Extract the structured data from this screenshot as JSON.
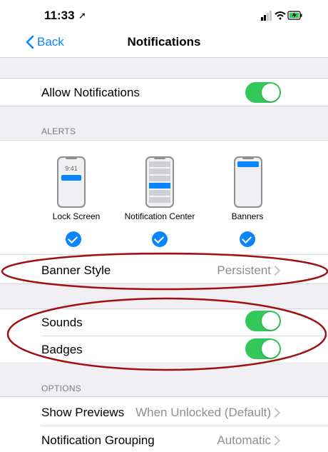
{
  "status_bar": {
    "time": "11:33"
  },
  "nav": {
    "back_label": "Back",
    "title": "Notifications"
  },
  "allow_notifications": {
    "label": "Allow Notifications",
    "enabled": true
  },
  "alerts": {
    "header": "ALERTS",
    "lock_screen": {
      "label": "Lock Screen",
      "preview_time": "9:41",
      "selected": true
    },
    "notification_center": {
      "label": "Notification Center",
      "selected": true
    },
    "banners": {
      "label": "Banners",
      "selected": true
    }
  },
  "banner_style": {
    "label": "Banner Style",
    "value": "Persistent"
  },
  "sounds": {
    "label": "Sounds",
    "enabled": true
  },
  "badges": {
    "label": "Badges",
    "enabled": true
  },
  "options": {
    "header": "OPTIONS",
    "show_previews": {
      "label": "Show Previews",
      "value": "When Unlocked (Default)"
    },
    "notification_grouping": {
      "label": "Notification Grouping",
      "value": "Automatic"
    }
  },
  "colors": {
    "accent": "#0a84ff",
    "toggle_on": "#34c759",
    "highlight": "#a01010"
  }
}
